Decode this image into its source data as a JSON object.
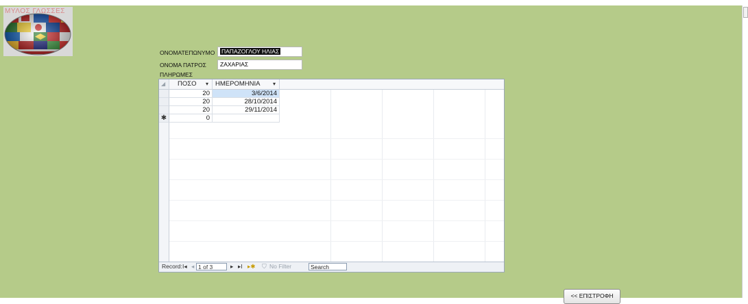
{
  "logo": {
    "caption": "ΜΥΛΟΣ ΓΛΩΣΣΕΣ"
  },
  "form": {
    "fullname_label": "ΟΝΟΜΑΤΕΠΩΝΥΜΟ",
    "fullname_value": "ΠΑΠΑΖΟΓΛΟΥ ΗΛΙΑΣ",
    "father_label": "ΟΝΟΜΑ ΠΑΤΡΟΣ",
    "father_value": "ΖΑΧΑΡΙΑΣ",
    "payments_label": "ΠΛΗΡΩΜΕΣ"
  },
  "grid": {
    "columns": [
      "ΠΟΣΟ",
      "ΗΜΕΡΟΜΗΝΙΑ"
    ],
    "sort_glyph": "▾",
    "rows": [
      {
        "poso": "20",
        "date": "3/6/2014"
      },
      {
        "poso": "20",
        "date": "28/10/2014"
      },
      {
        "poso": "20",
        "date": "29/11/2014"
      }
    ],
    "new_row": {
      "marker": "✱",
      "poso": "0",
      "date": ""
    }
  },
  "navigator": {
    "record_label": "Record:",
    "first_glyph": "I◂",
    "prev_glyph": "◂",
    "position": "1 of 3",
    "next_glyph": "▸",
    "last_glyph": "▸I",
    "new_glyph": "▸✱",
    "filter_label": "No Filter",
    "search_placeholder": "Search"
  },
  "buttons": {
    "back_label": "<< ΕΠΙΣΤΡΟΦΗ"
  },
  "colors": {
    "form_background": "#b5cb89",
    "selection": "#cfe3f8"
  }
}
